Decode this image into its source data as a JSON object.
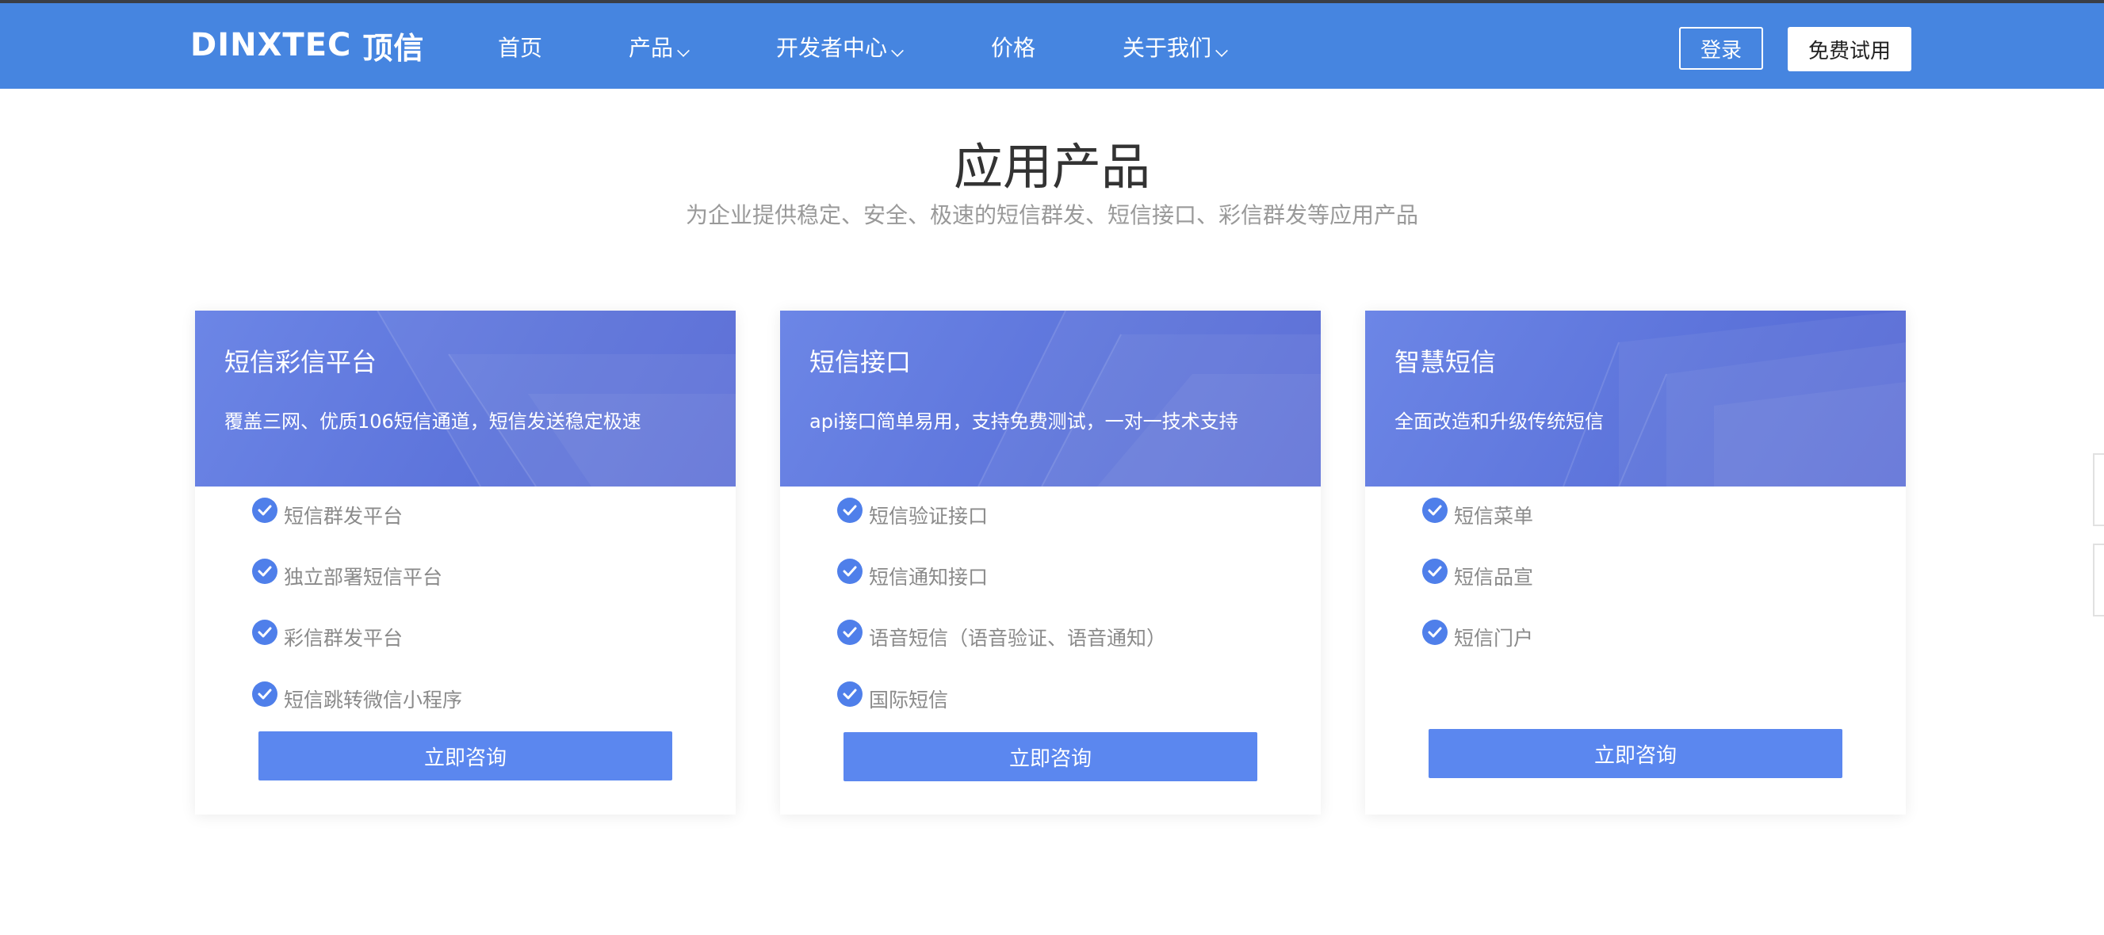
{
  "header": {
    "logo_latin": "DINXTEC",
    "logo_cn": "顶信",
    "nav": [
      {
        "label": "首页",
        "has_dropdown": false
      },
      {
        "label": "产品",
        "has_dropdown": true
      },
      {
        "label": "开发者中心",
        "has_dropdown": true
      },
      {
        "label": "价格",
        "has_dropdown": false
      },
      {
        "label": "关于我们",
        "has_dropdown": true
      }
    ],
    "login_label": "登录",
    "trial_label": "免费试用"
  },
  "section": {
    "title": "应用产品",
    "subtitle": "为企业提供稳定、安全、极速的短信群发、短信接口、彩信群发等应用产品"
  },
  "cards": [
    {
      "title": "短信彩信平台",
      "desc": "覆盖三网、优质106短信通道，短信发送稳定极速",
      "features": [
        "短信群发平台",
        "独立部署短信平台",
        "彩信群发平台",
        "短信跳转微信小程序"
      ],
      "cta": "立即咨询"
    },
    {
      "title": "短信接口",
      "desc": "api接口简单易用，支持免费测试，一对一技术支持",
      "features": [
        "短信验证接口",
        "短信通知接口",
        "语音短信（语音验证、语音通知）",
        "国际短信"
      ],
      "cta": "立即咨询"
    },
    {
      "title": "智慧短信",
      "desc": "全面改造和升级传统短信",
      "features": [
        "短信菜单",
        "短信品宣",
        "短信门户"
      ],
      "cta": "立即咨询"
    }
  ],
  "colors": {
    "nav_bg": "#4685e0",
    "card_header": "#5d74db",
    "check": "#4f7fea",
    "cta": "#5b87ef"
  }
}
